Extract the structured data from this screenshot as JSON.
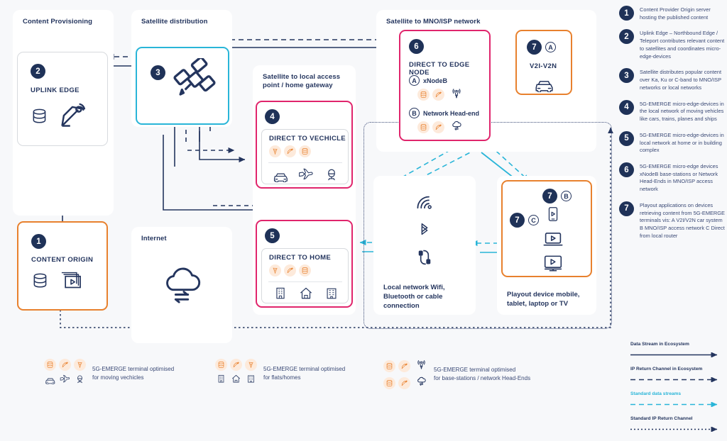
{
  "colors": {
    "navy": "#1f3258",
    "orange": "#e8812e",
    "pink": "#e0256c",
    "cyan": "#29b5d8",
    "gray_border": "#d7dade",
    "background": "#f7f8fa",
    "chip_bg": "#fdeadb"
  },
  "groups": {
    "content_provisioning": "Content Provisioning",
    "satellite_distribution": "Satellite distribution",
    "satellite_local_access": "Satellite to local access point / home gateway",
    "satellite_mno": "Satellite to MNO/ISP network",
    "internet": "Internet"
  },
  "cards": {
    "uplink_edge": {
      "badge": "2",
      "label": "UPLINK EDGE"
    },
    "content_origin": {
      "badge": "1",
      "label": "CONTENT ORIGIN"
    },
    "satellite": {
      "badge": "3"
    },
    "direct_to_vehicle": {
      "badge": "4",
      "label": "DIRECT TO VECHICLE"
    },
    "direct_to_home": {
      "badge": "5",
      "label": "DIRECT TO HOME"
    },
    "direct_to_edge_node": {
      "badge": "6",
      "label": "DIRECT TO EDGE NODE",
      "sub_a": {
        "letter": "A",
        "label": "xNodeB"
      },
      "sub_b": {
        "letter": "B",
        "label": "Network Head-end"
      }
    },
    "v2i_v2n": {
      "badge": "7",
      "letter": "A",
      "label": "V2I-V2N"
    },
    "playout": {
      "badge_b": "7",
      "letter_b": "B",
      "badge_c": "7",
      "letter_c": "C"
    }
  },
  "captions": {
    "local_network": "Local network Wifi,\nBluetooth or cable\nconnection",
    "playout_devices": "Playout device mobile,\ntablet, laptop or TV"
  },
  "legend": [
    {
      "num": "1",
      "text": "Content Provider Origin server hosting the published content"
    },
    {
      "num": "2",
      "text": "Uplink Edge – Northbound Edge  / Teleport contributes relevant content to satellites and coordinates micro-edge-devices"
    },
    {
      "num": "3",
      "text": "Satellite distributes popular content over Ka, Ku or C-band to MNO/ISP networks or local networks"
    },
    {
      "num": "4",
      "text": "5G-EMERGE micro-edge-devices in the local network of moving vehicles like cars, trains, planes and ships"
    },
    {
      "num": "5",
      "text": "5G-EMERGE micro-edge-devices in local network at home or in building complex"
    },
    {
      "num": "6",
      "text": "5G-EMERGE micro-edge devices xNodeB base-stations or Network Head-Ends in MNO/ISP access network"
    },
    {
      "num": "7",
      "text": "Playout applications on devices retrieving content from 5G-EMERGE terminals vis: A V2I/V2N car system B MNO/ISP access network C Direct from local router"
    }
  ],
  "streams": [
    {
      "label": "Data Stream in Ecosystem",
      "style": "solid",
      "color": "#24355e"
    },
    {
      "label": "IP Return Channel in Ecosystem",
      "style": "dashed",
      "color": "#24355e"
    },
    {
      "label": "Standard data streams",
      "style": "dashed",
      "color": "#29b5d8"
    },
    {
      "label": "Standard IP Return Channel",
      "style": "dotted",
      "color": "#24355e"
    }
  ],
  "terminal_legend": [
    {
      "text": "5G-EMERGE terminal optimised\nfor moving vechicles",
      "icons_top": [
        "database",
        "dish",
        "antenna"
      ],
      "icons_bottom": [
        "car",
        "plane",
        "train"
      ]
    },
    {
      "text": "5G-EMERGE terminal optimised\nfor flats/homes",
      "icons_top": [
        "database",
        "dish",
        "antenna"
      ],
      "icons_bottom": [
        "building",
        "house",
        "apartment"
      ]
    },
    {
      "text": "5G-EMERGE terminal optimised\nfor base-stations / network Head-Ends",
      "icons_top": [
        "database",
        "dish",
        "tower"
      ],
      "icons_bottom": [
        "database",
        "dish",
        "cloud"
      ]
    }
  ]
}
